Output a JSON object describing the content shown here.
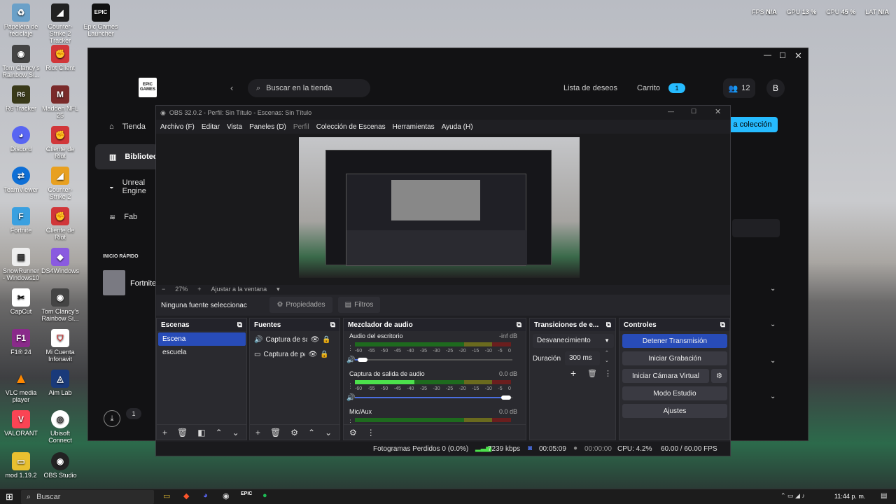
{
  "overlay": {
    "fps_label": "FPS",
    "fps_value": "N/A",
    "gpu_label": "GPU",
    "gpu_value": "13 %",
    "cpu_label": "CPU",
    "cpu_value": "45 %",
    "lat_label": "LAT",
    "lat_value": "N/A"
  },
  "desktop_icons": [
    "Papelera de reciclaje",
    "Counter-Strike 2 Tracker",
    "Epic Games Launcher",
    "Tom Clancy's Rainbow Si...",
    "Riot Client",
    "R6 Tracker",
    "Madden NFL 25",
    "Discord",
    "Cliente de Riot",
    "TeamViewer",
    "Counter-Strike 2",
    "Fortnite",
    "Cliente de Riot",
    "SnowRunner - Windows10",
    "DS4Windows",
    "CapCut",
    "Tom Clancy's Rainbow Si...",
    "F1® 24",
    "Mi Cuenta Infonavit",
    "VLC media player",
    "Aim Lab",
    "VALORANT",
    "Ubisoft Connect",
    "mod 1.19.2",
    "OBS Studio"
  ],
  "epic": {
    "logo": "EPIC GAMES",
    "search_placeholder": "Buscar en la tienda",
    "wishlist": "Lista de deseos",
    "cart": "Carrito",
    "cart_count": "1",
    "friends_count": "12",
    "avatar": "B",
    "nav": [
      "Tienda",
      "Biblioteca",
      "Unreal Engine",
      "Fab"
    ],
    "quick_launch_title": "INICIO RÁPIDO",
    "quick_launch_item": "Fortnite",
    "collection_button": "a colección",
    "downloads_count": "1"
  },
  "obs": {
    "title": "OBS 32.0.2 - Perfil: Sin Título - Escenas: Sin Título",
    "menu": [
      "Archivo (F)",
      "Editar",
      "Vista",
      "Paneles (D)",
      "Perfil",
      "Colección de Escenas",
      "Herramientas",
      "Ayuda (H)"
    ],
    "zoom": "27%",
    "fit": "Ajustar a la ventana",
    "no_source": "Ninguna fuente seleccionac",
    "properties": "Propiedades",
    "filters": "Filtros",
    "scenes_title": "Escenas",
    "scenes": [
      "Escena",
      "escuela"
    ],
    "sources_title": "Fuentes",
    "sources": [
      "Captura de sa",
      "Captura de pa"
    ],
    "mixer_title": "Mezclador de audio",
    "mixer": [
      {
        "name": "Audio del escritorio",
        "db": "-inf dB",
        "level": 0,
        "volume": 0.05
      },
      {
        "name": "Captura de salida de audio",
        "db": "0.0 dB",
        "level": 0.38,
        "volume": 0.97
      },
      {
        "name": "Mic/Aux",
        "db": "0.0 dB",
        "level": 0,
        "volume": 0.97
      }
    ],
    "scale": [
      "-60",
      "-55",
      "-50",
      "-45",
      "-40",
      "-35",
      "-30",
      "-25",
      "-20",
      "-15",
      "-10",
      "-5",
      "0"
    ],
    "transitions_title": "Transiciones de e...",
    "transition": "Desvanecimiento",
    "duration_label": "Duración",
    "duration": "300 ms",
    "controls_title": "Controles",
    "controls": {
      "stop": "Detener Transmisión",
      "record": "Iniciar Grabación",
      "vcam": "Iniciar Cámara Virtual",
      "studio": "Modo Estudio",
      "settings": "Ajustes"
    },
    "status": {
      "dropped": "Fotogramas Perdidos 0 (0.0%)",
      "kbps": "7239 kbps",
      "stream_time": "00:05:09",
      "rec_time": "00:00:00",
      "cpu": "CPU: 4.2%",
      "fps": "60.00 / 60.00 FPS"
    }
  },
  "taskbar": {
    "search": "Buscar",
    "time": "11:44 p. m."
  },
  "colors": {
    "obs_primary": "#284cb8",
    "epic_accent": "#26bbff",
    "meter_green": "#4ce04c"
  }
}
